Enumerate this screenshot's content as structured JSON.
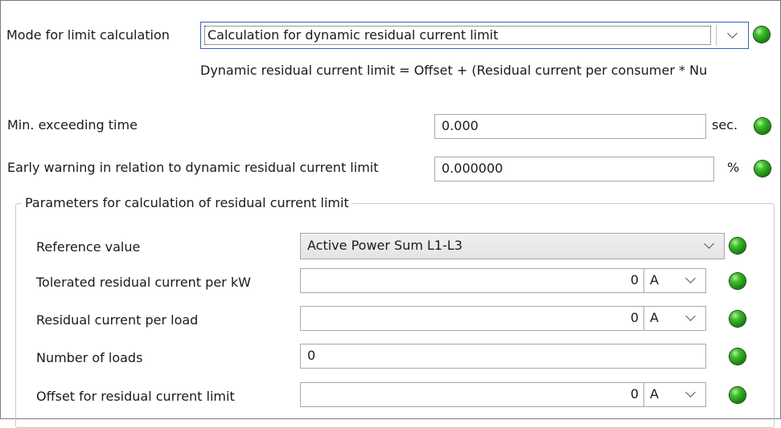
{
  "mode": {
    "label": "Mode for limit calculation",
    "selected": "Calculation for dynamic residual current limit",
    "formula": "Dynamic residual current limit = Offset + (Residual current per consumer * Nu"
  },
  "exceeding_time": {
    "label": "Min. exceeding time",
    "value": "0.000",
    "unit": "sec."
  },
  "early_warning": {
    "label": "Early warning in relation to dynamic residual current limit",
    "value": "0.000000",
    "unit": "%"
  },
  "group": {
    "title": "Parameters for calculation of residual current limit",
    "reference": {
      "label": "Reference value",
      "selected": "Active Power Sum L1-L3"
    },
    "tolerated": {
      "label": "Tolerated residual current per kW",
      "value": "0",
      "unit": "A"
    },
    "per_load": {
      "label": "Residual current per load",
      "value": "0",
      "unit": "A"
    },
    "num_loads": {
      "label": "Number of loads",
      "value": "0"
    },
    "offset": {
      "label": "Offset for residual current limit",
      "value": "0",
      "unit": "A"
    }
  },
  "status_color": "#2a9a1c"
}
